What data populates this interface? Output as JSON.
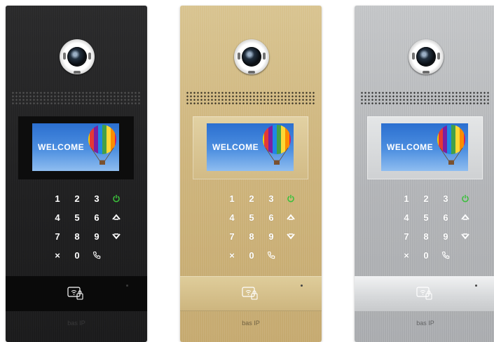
{
  "panels": [
    {
      "finish": "black",
      "screen_text": "WELCOME",
      "brand": "bas IP"
    },
    {
      "finish": "gold",
      "screen_text": "WELCOME",
      "brand": "bas IP"
    },
    {
      "finish": "silver",
      "screen_text": "WELCOME",
      "brand": "bas IP"
    }
  ],
  "keypad": {
    "k1": "1",
    "k2": "2",
    "k3": "3",
    "k4": "4",
    "k5": "5",
    "k6": "6",
    "k7": "7",
    "k8": "8",
    "k9": "9",
    "k0": "0",
    "cancel": "×"
  },
  "icons": {
    "power": "power-icon",
    "up": "chevron-up-icon",
    "down": "chevron-down-icon",
    "call": "phone-icon",
    "card": "card-reader-icon"
  },
  "colors": {
    "power_icon": "#3bbf3b",
    "black_finish": "#222223",
    "gold_finish": "#d0b87f",
    "silver_finish": "#b5b7b9",
    "screen_blue": "#3a80d8"
  }
}
